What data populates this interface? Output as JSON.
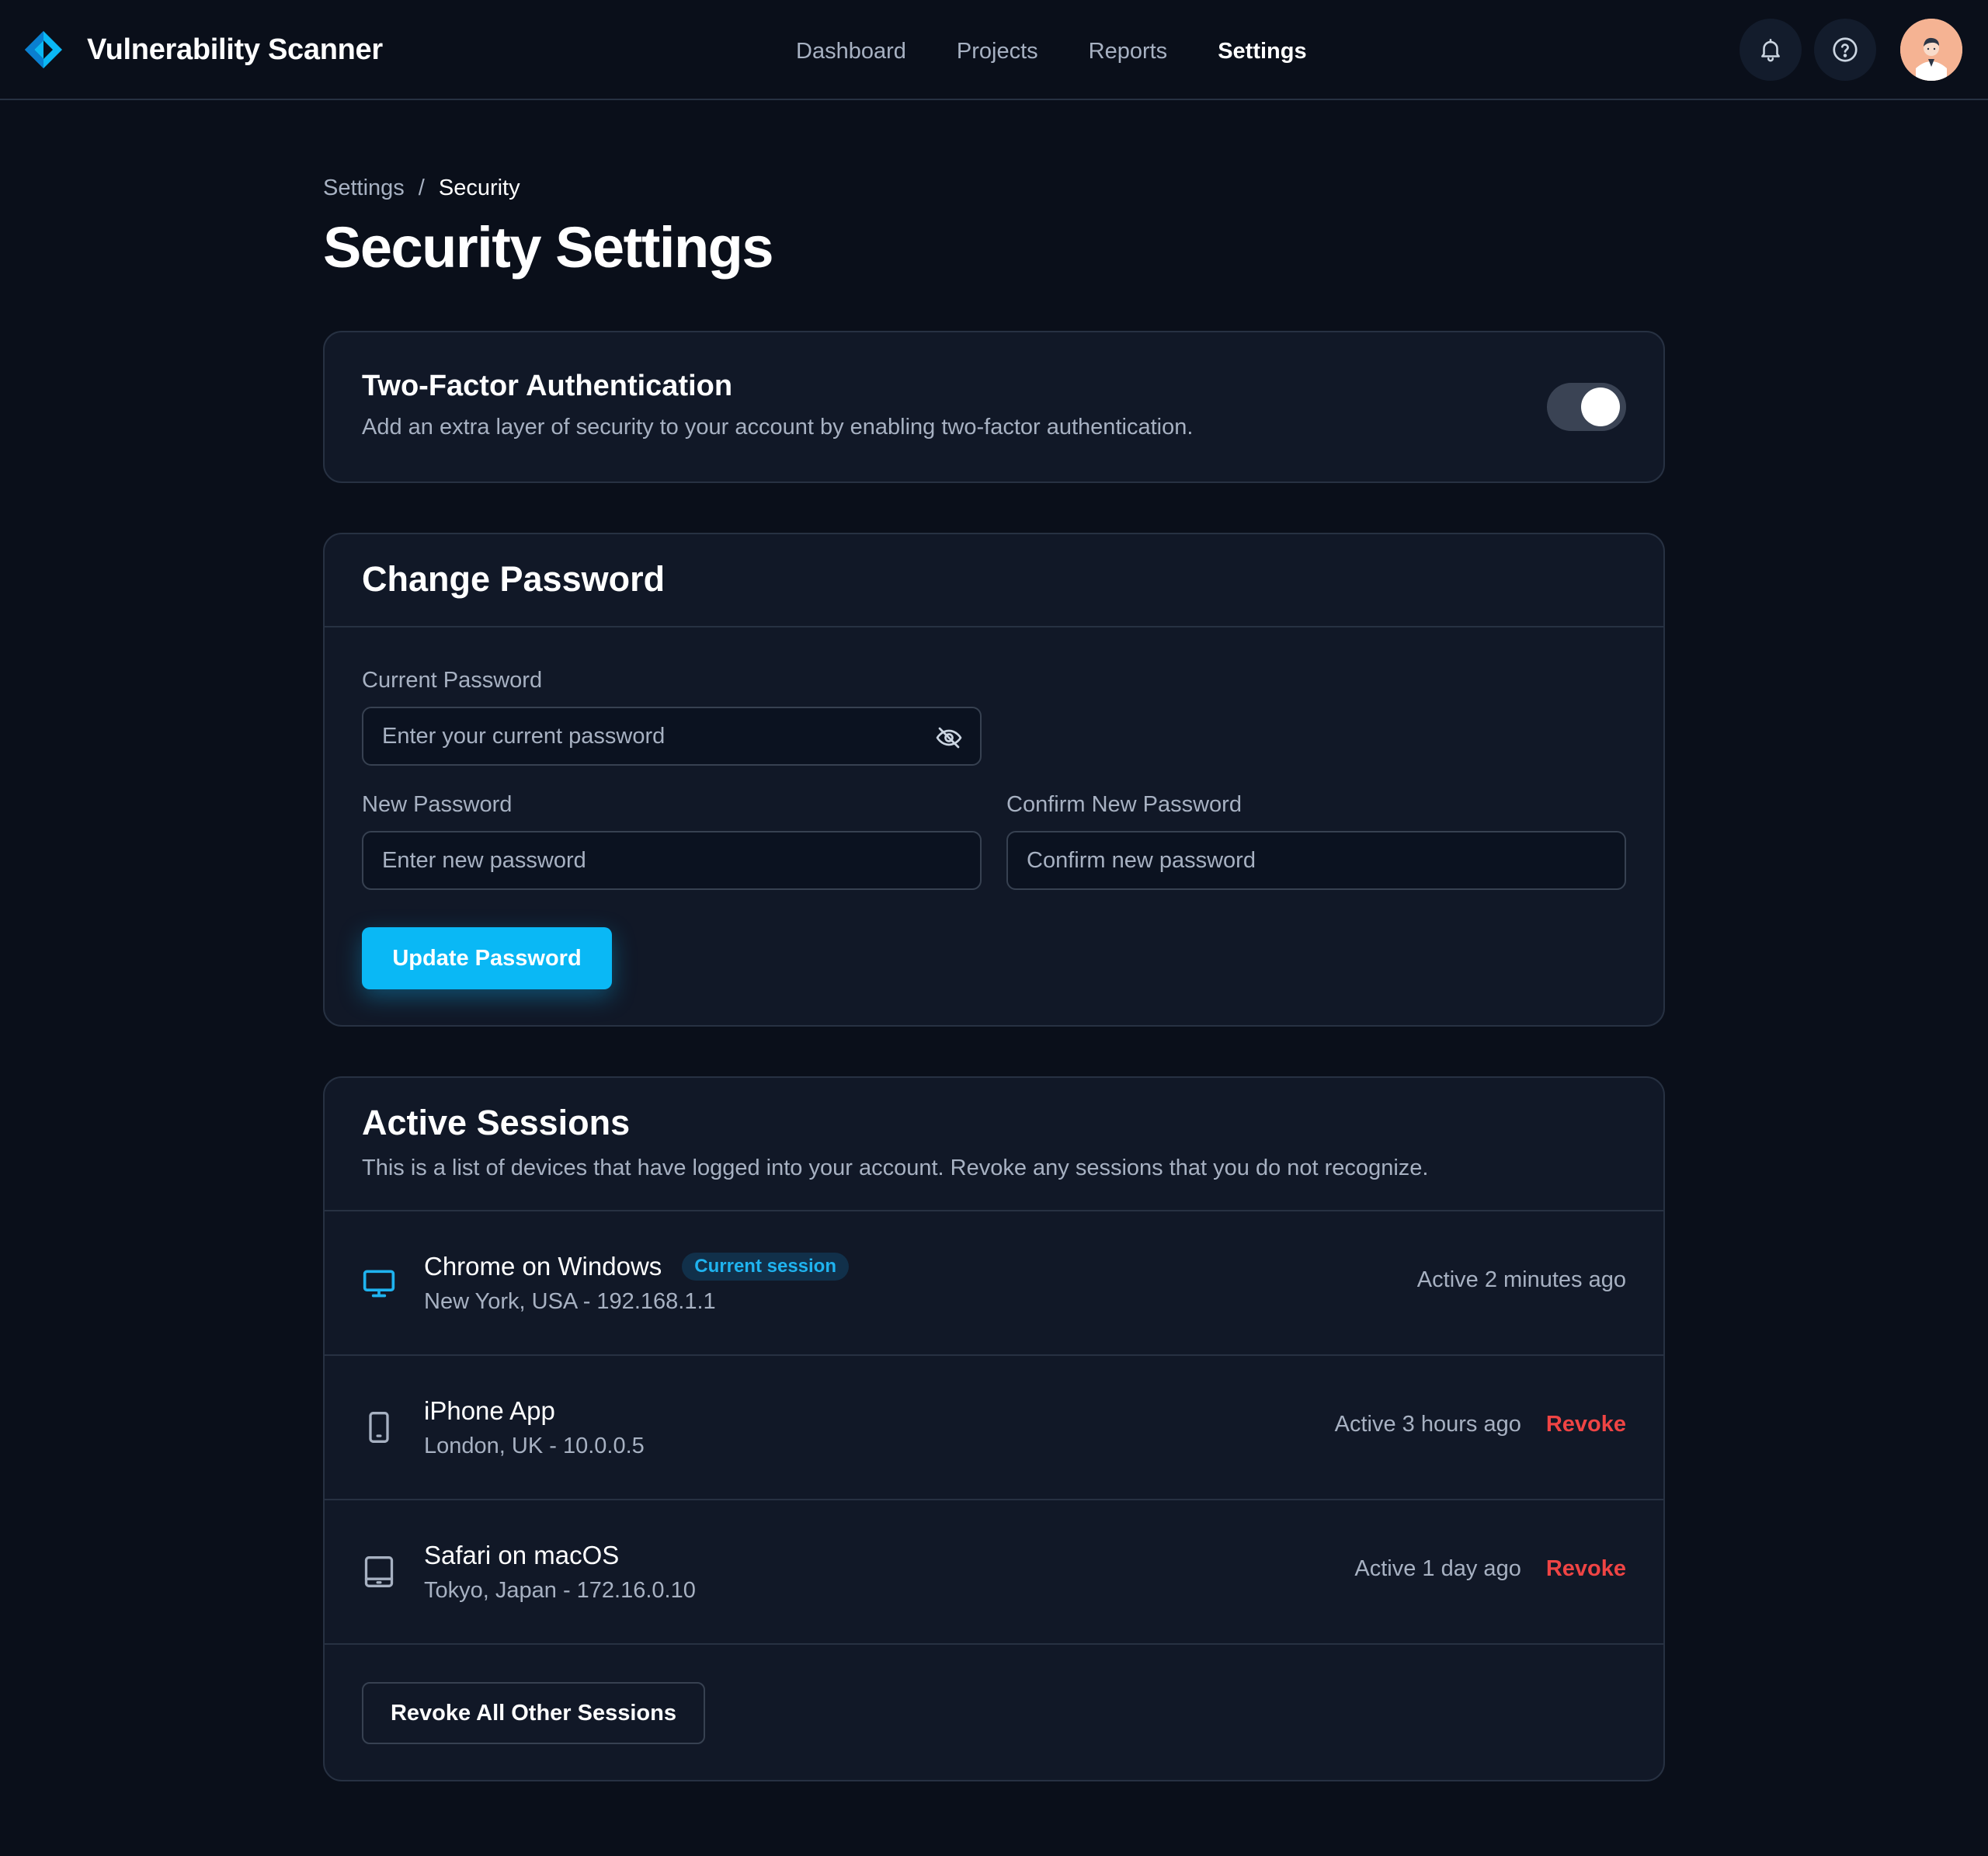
{
  "app": {
    "title": "Vulnerability Scanner",
    "logo_icon": "diamond-logo-icon",
    "accent_color": "#0ab8f5"
  },
  "nav": {
    "items": [
      {
        "label": "Dashboard",
        "active": false
      },
      {
        "label": "Projects",
        "active": false
      },
      {
        "label": "Reports",
        "active": false
      },
      {
        "label": "Settings",
        "active": true
      }
    ]
  },
  "header_icons": {
    "notifications": "bell-icon",
    "help": "help-circle-icon",
    "avatar": "user-avatar"
  },
  "breadcrumb": {
    "parent": "Settings",
    "separator": "/",
    "current": "Security"
  },
  "page": {
    "title": "Security Settings"
  },
  "two_factor": {
    "title": "Two-Factor Authentication",
    "description": "Add an extra layer of security to your account by enabling two-factor authentication.",
    "enabled": true
  },
  "change_password": {
    "title": "Change Password",
    "current_label": "Current Password",
    "current_placeholder": "Enter your current password",
    "new_label": "New Password",
    "new_placeholder": "Enter new password",
    "confirm_label": "Confirm New Password",
    "confirm_placeholder": "Confirm new password",
    "submit_label": "Update Password"
  },
  "sessions": {
    "title": "Active Sessions",
    "description": "This is a list of devices that have logged into your account. Revoke any sessions that you do not recognize.",
    "items": [
      {
        "device": "Chrome on Windows",
        "icon": "desktop-icon",
        "badge": "Current session",
        "location": "New York, USA - 192.168.1.1",
        "last_active": "Active 2 minutes ago"
      },
      {
        "device": "iPhone App",
        "icon": "phone-icon",
        "location": "London, UK - 10.0.0.5",
        "last_active": "Active 3 hours ago",
        "action": "Revoke"
      },
      {
        "device": "Safari on macOS",
        "icon": "tablet-icon",
        "location": "Tokyo, Japan - 172.16.0.10",
        "last_active": "Active 1 day ago",
        "action": "Revoke"
      }
    ],
    "revoke_all_label": "Revoke All Other Sessions"
  }
}
